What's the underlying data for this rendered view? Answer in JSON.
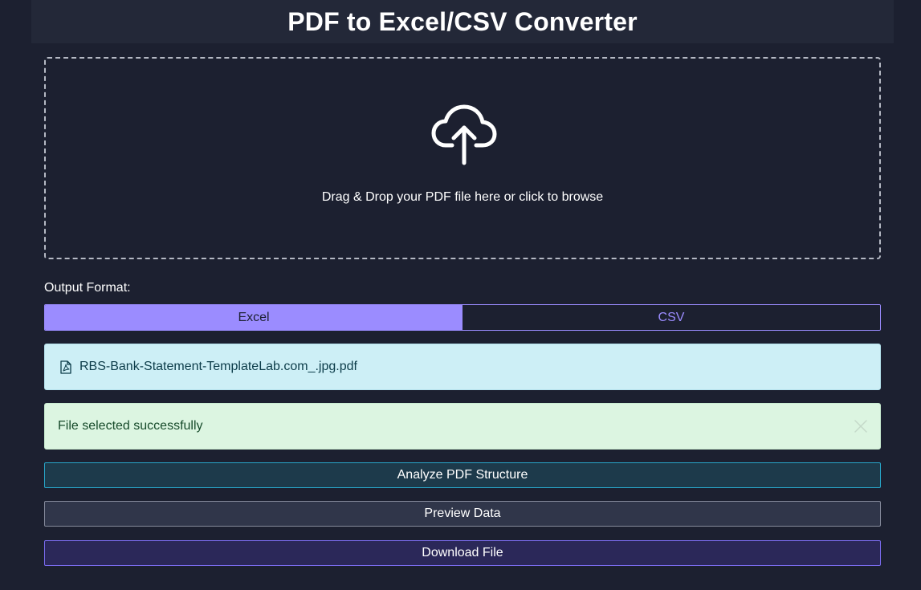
{
  "header": {
    "title": "PDF to Excel/CSV Converter"
  },
  "dropzone": {
    "icon": "cloud-upload-icon",
    "text": "Drag & Drop your PDF file here or click to browse"
  },
  "output_format": {
    "label": "Output Format:",
    "options": [
      "Excel",
      "CSV"
    ],
    "selected": "Excel"
  },
  "file": {
    "icon": "pdf-file-icon",
    "name": "RBS-Bank-Statement-TemplateLab.com_.jpg.pdf"
  },
  "alert": {
    "message": "File selected successfully",
    "close_icon": "close-icon"
  },
  "actions": {
    "analyze_label": "Analyze PDF Structure",
    "preview_label": "Preview Data",
    "download_label": "Download File"
  },
  "colors": {
    "background": "#1c2030",
    "accent": "#9b8cff",
    "info_bg": "#cdeff6",
    "success_bg": "#dcf5e1"
  }
}
